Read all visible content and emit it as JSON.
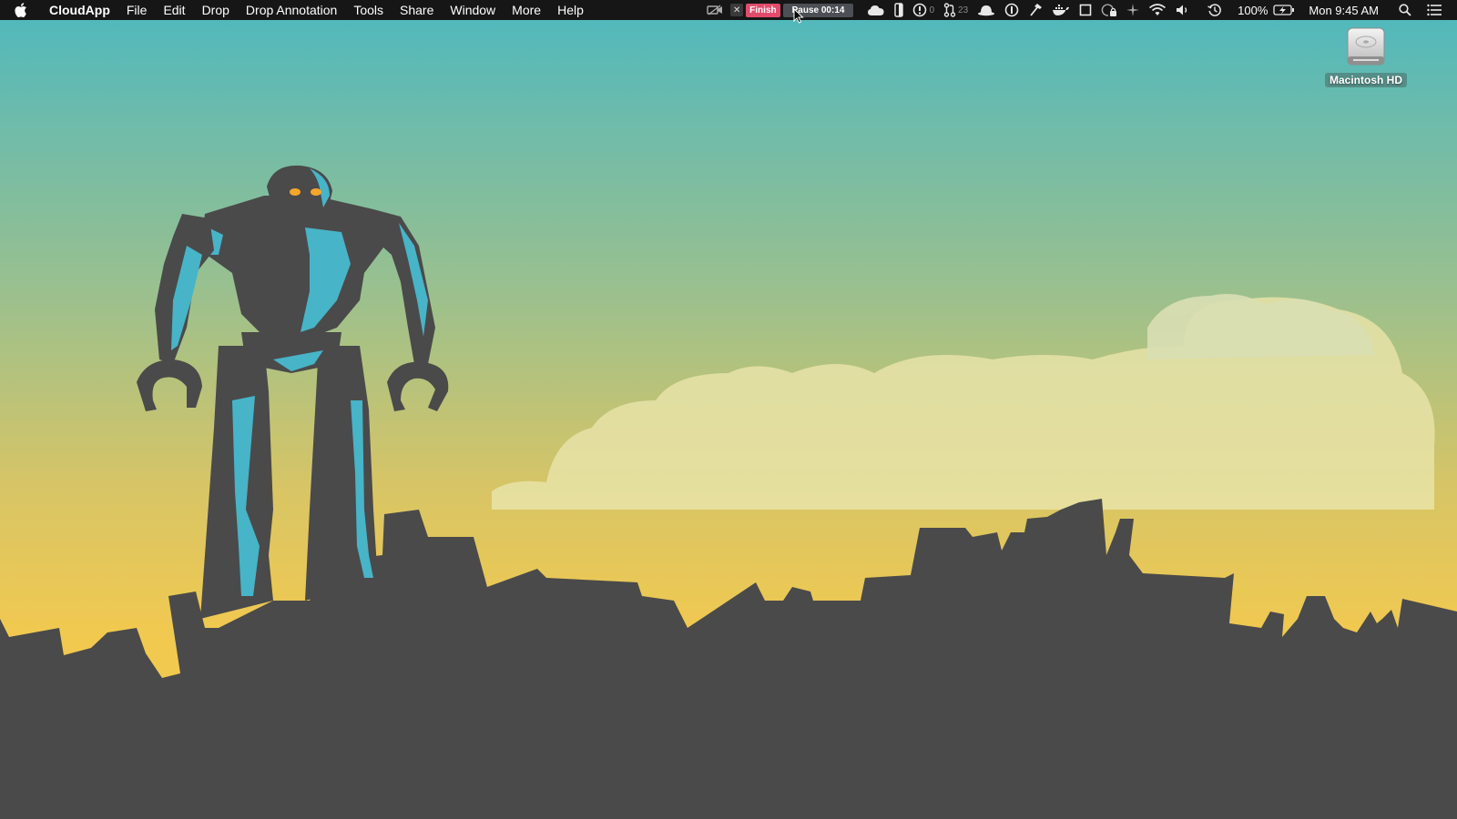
{
  "menubar": {
    "app_name": "CloudApp",
    "items": [
      "File",
      "Edit",
      "Drop",
      "Drop Annotation",
      "Tools",
      "Share",
      "Window",
      "More",
      "Help"
    ]
  },
  "status_bar": {
    "close_glyph": "✕",
    "finish_label": "Finish",
    "pause_label": "Pause 00:14",
    "counter_1": "0",
    "counter_2": "23",
    "battery": "100%",
    "clock": "Mon 9:45 AM"
  },
  "desktop": {
    "icon_label": "Macintosh HD"
  },
  "colors": {
    "sky_top": "#4db8bf",
    "sky_bottom": "#f2c94f",
    "city": "#4a4a4a",
    "robot_accent": "#47b4c8",
    "finish": "#e34b6c"
  }
}
